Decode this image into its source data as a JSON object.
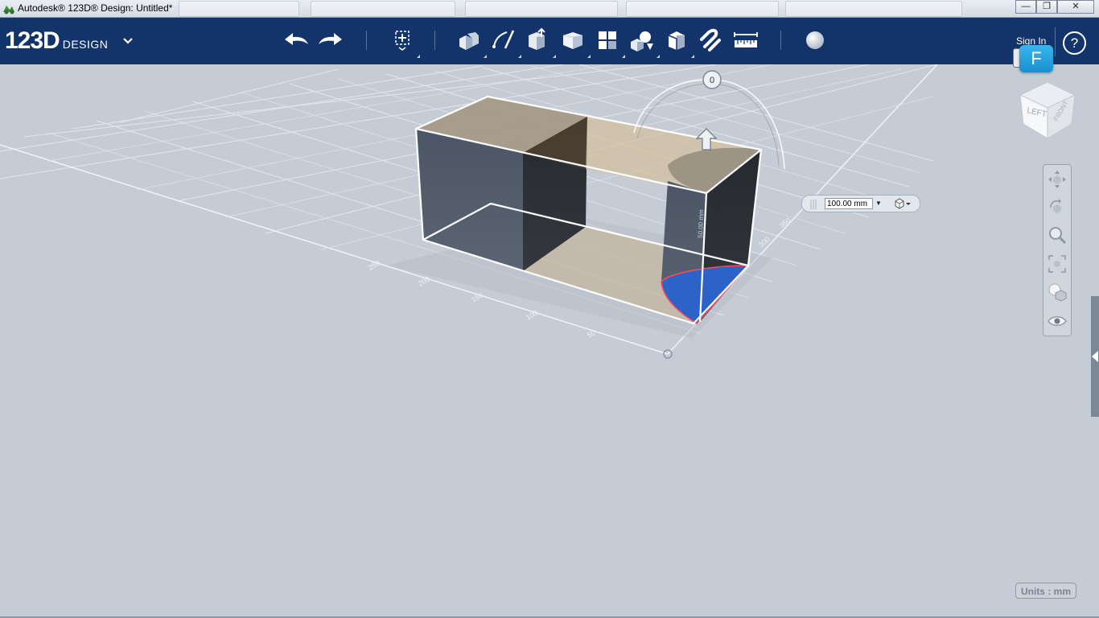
{
  "window": {
    "title": "Autodesk® 123D® Design: Untitled*",
    "minimize_label": "—",
    "maximize_label": "❐",
    "close_label": "✕"
  },
  "app": {
    "logo_number": "123D",
    "logo_word": "DESIGN",
    "sign_in_label": "Sign In",
    "help_label": "?",
    "user_initial": "F"
  },
  "toolbar": {
    "tools": [
      "undo-icon",
      "redo-icon",
      "transform-icon",
      "primitives-icon",
      "sketch-icon",
      "construct-icon",
      "modify-icon",
      "pattern-icon",
      "group-icon",
      "combine-icon",
      "measure-icon",
      "snap-icon",
      "ruler-icon",
      "material-icon"
    ]
  },
  "viewport": {
    "viewcube_label": "LEFT",
    "dimension_value": "100.00 mm",
    "rotation_handle_label": "0",
    "axis_ticks": [
      "250",
      "200",
      "150",
      "100",
      "50",
      "300",
      "350"
    ],
    "units_label": "Units : mm"
  },
  "colors": {
    "toolbar_bg": "#13346a",
    "grid": "#e8ecf1",
    "solid_dark": "#4d5868",
    "translucent_tan": "#c9b390",
    "selected_face": "#2d63c8",
    "selected_edge": "#ff4a5a"
  }
}
